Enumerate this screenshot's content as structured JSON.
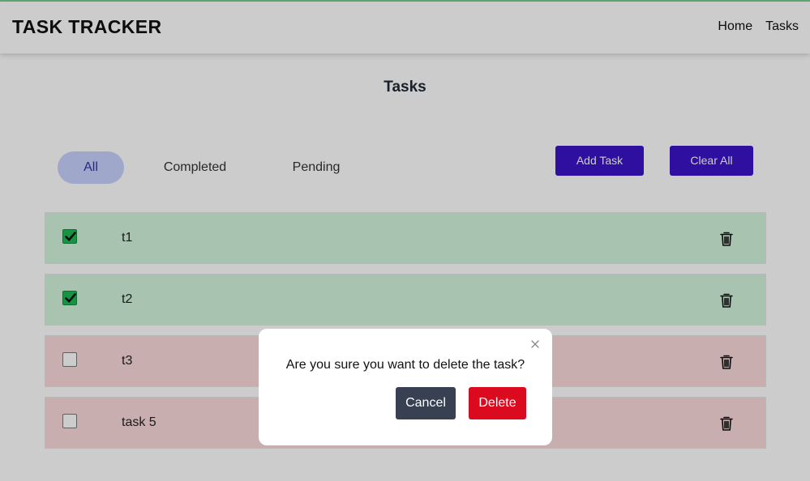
{
  "app": {
    "brand": "TASK TRACKER",
    "nav": {
      "home": "Home",
      "tasks": "Tasks"
    }
  },
  "page": {
    "title": "Tasks"
  },
  "filters": [
    {
      "label": "All",
      "active": true
    },
    {
      "label": "Completed",
      "active": false
    },
    {
      "label": "Pending",
      "active": false
    }
  ],
  "toolbar": {
    "add_label": "Add Task",
    "clear_label": "Clear All"
  },
  "tasks": [
    {
      "name": "t1",
      "completed": true
    },
    {
      "name": "t2",
      "completed": true
    },
    {
      "name": "t3",
      "completed": false
    },
    {
      "name": "task 5",
      "completed": false
    }
  ],
  "modal": {
    "message": "Are you sure you want to delete the task?",
    "cancel_label": "Cancel",
    "delete_label": "Delete"
  },
  "colors": {
    "accent": "#3b13c8",
    "completed_row": "#d2f5dc",
    "pending_row": "#fbdada",
    "checkbox_checked": "#1db954",
    "delete": "#dc0a1f",
    "cancel": "#374151"
  },
  "icons": {
    "trash": "trash-icon",
    "check": "check-icon",
    "close": "close-icon"
  }
}
